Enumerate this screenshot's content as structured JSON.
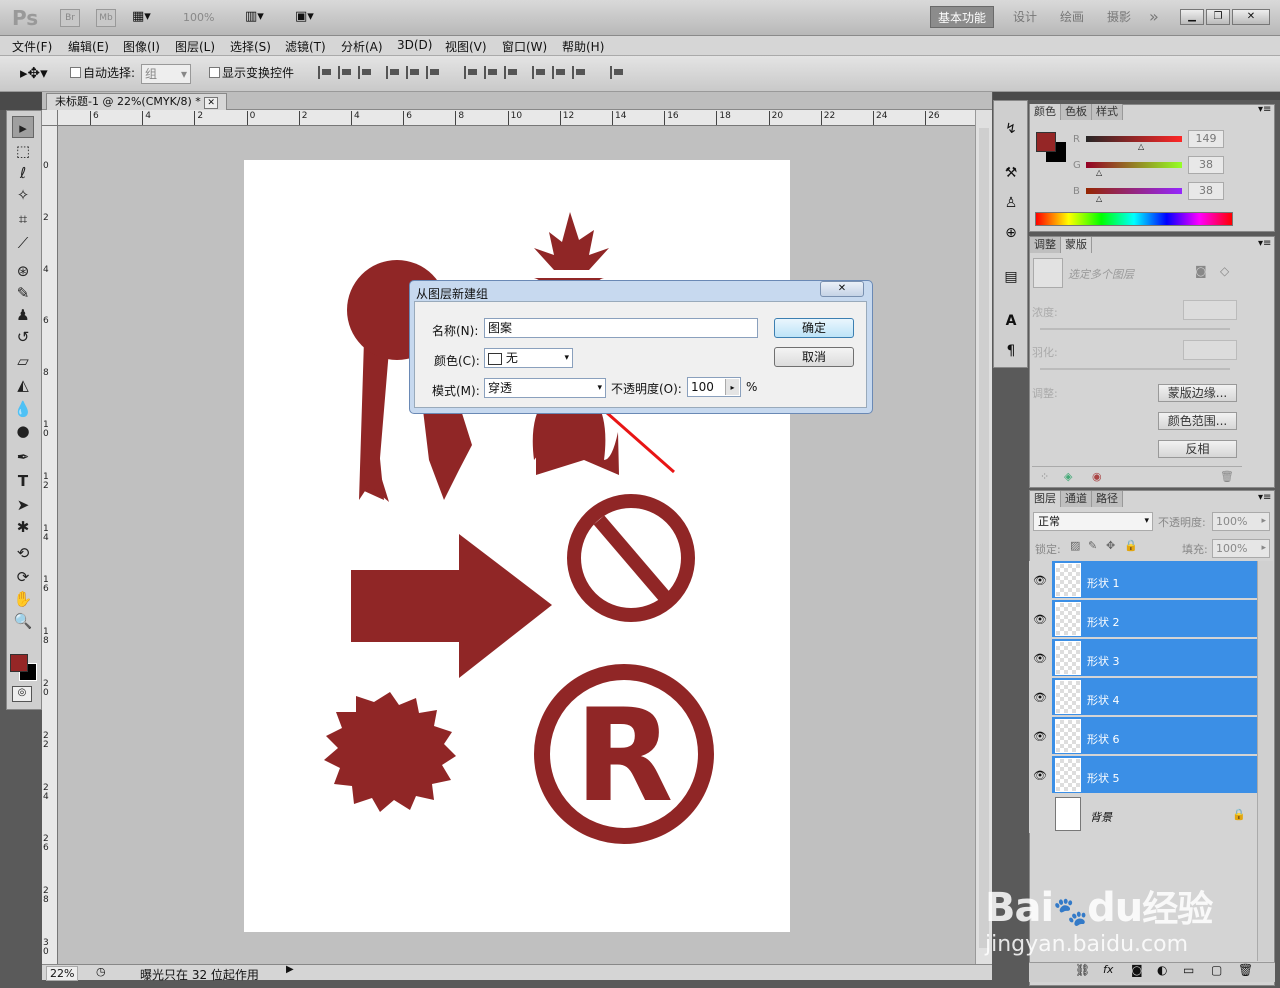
{
  "topbar": {
    "logo": "Ps",
    "br": "Br",
    "mb": "Mb",
    "zoom": "100%",
    "workspaces": [
      "基本功能",
      "设计",
      "绘画",
      "摄影"
    ],
    "more": "»"
  },
  "menu": [
    "文件(F)",
    "编辑(E)",
    "图像(I)",
    "图层(L)",
    "选择(S)",
    "滤镜(T)",
    "分析(A)",
    "3D(D)",
    "视图(V)",
    "窗口(W)",
    "帮助(H)"
  ],
  "options": {
    "auto_select_label": "自动选择:",
    "auto_select_value": "组",
    "show_transform_label": "显示变换控件"
  },
  "document": {
    "tab_title": "未标题-1 @ 22%(CMYK/8) *",
    "ruler_h": [
      "6",
      "4",
      "2",
      "0",
      "2",
      "4",
      "6",
      "8",
      "10",
      "12",
      "14",
      "16",
      "18",
      "20",
      "22",
      "24",
      "26"
    ],
    "ruler_v": [
      "0",
      "2",
      "4",
      "6",
      "8",
      "10",
      "12",
      "14",
      "16",
      "18",
      "20",
      "22",
      "24",
      "26",
      "28",
      "30"
    ]
  },
  "status": {
    "zoom": "22%",
    "info": "曝光只在 32 位起作用"
  },
  "color_panel": {
    "tabs": [
      "颜色",
      "色板",
      "样式"
    ],
    "r_label": "R",
    "g_label": "G",
    "b_label": "B",
    "r": "149",
    "g": "38",
    "b": "38",
    "fg_color": "#952626"
  },
  "adjust_panel": {
    "tabs": [
      "调整",
      "蒙版"
    ],
    "hint": "选定多个图层",
    "density_label": "浓度:",
    "feather_label": "羽化:",
    "refine_label": "调整:",
    "mask_edge": "蒙版边缘...",
    "color_range": "颜色范围...",
    "invert": "反相"
  },
  "layers_panel": {
    "tabs": [
      "图层",
      "通道",
      "路径"
    ],
    "blend_mode": "正常",
    "opacity_label": "不透明度:",
    "opacity": "100%",
    "lock_label": "锁定:",
    "fill_label": "填充:",
    "fill": "100%",
    "layers": [
      "形状 1",
      "形状 2",
      "形状 3",
      "形状 4",
      "形状 6",
      "形状 5"
    ],
    "background": "背景"
  },
  "dialog": {
    "title": "从图层新建组",
    "name_label": "名称(N):",
    "name_value": "图案",
    "color_label": "颜色(C):",
    "color_value": "无",
    "mode_label": "模式(M):",
    "mode_value": "穿透",
    "opacity_label": "不透明度(O):",
    "opacity_value": "100",
    "percent": "%",
    "ok": "确定",
    "cancel": "取消"
  },
  "watermark": {
    "brand_a": "Bai",
    "brand_b": "du",
    "brand_c": "经验",
    "url": "jingyan.baidu.com"
  }
}
